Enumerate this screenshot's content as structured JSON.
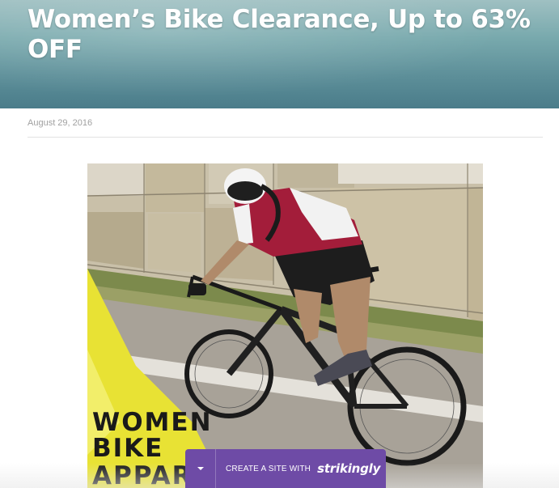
{
  "post": {
    "title": "Women’s Bike Clearance, Up to 63% OFF",
    "date": "August 29, 2016",
    "image": {
      "overlay_lines": [
        "WOMEN",
        "BIKE",
        "APPAR"
      ]
    }
  },
  "promo": {
    "text": "CREATE A SITE WITH",
    "brand": "strikingly",
    "toggle_icon": "chevron-down-icon"
  },
  "colors": {
    "hero_gradient_top": "#9fc0c2",
    "hero_gradient_bottom": "#4a7c8a",
    "promo_bar": "#6e4ba6",
    "date_text": "#a0a0a0",
    "banner_yellow": "#e8e234"
  }
}
